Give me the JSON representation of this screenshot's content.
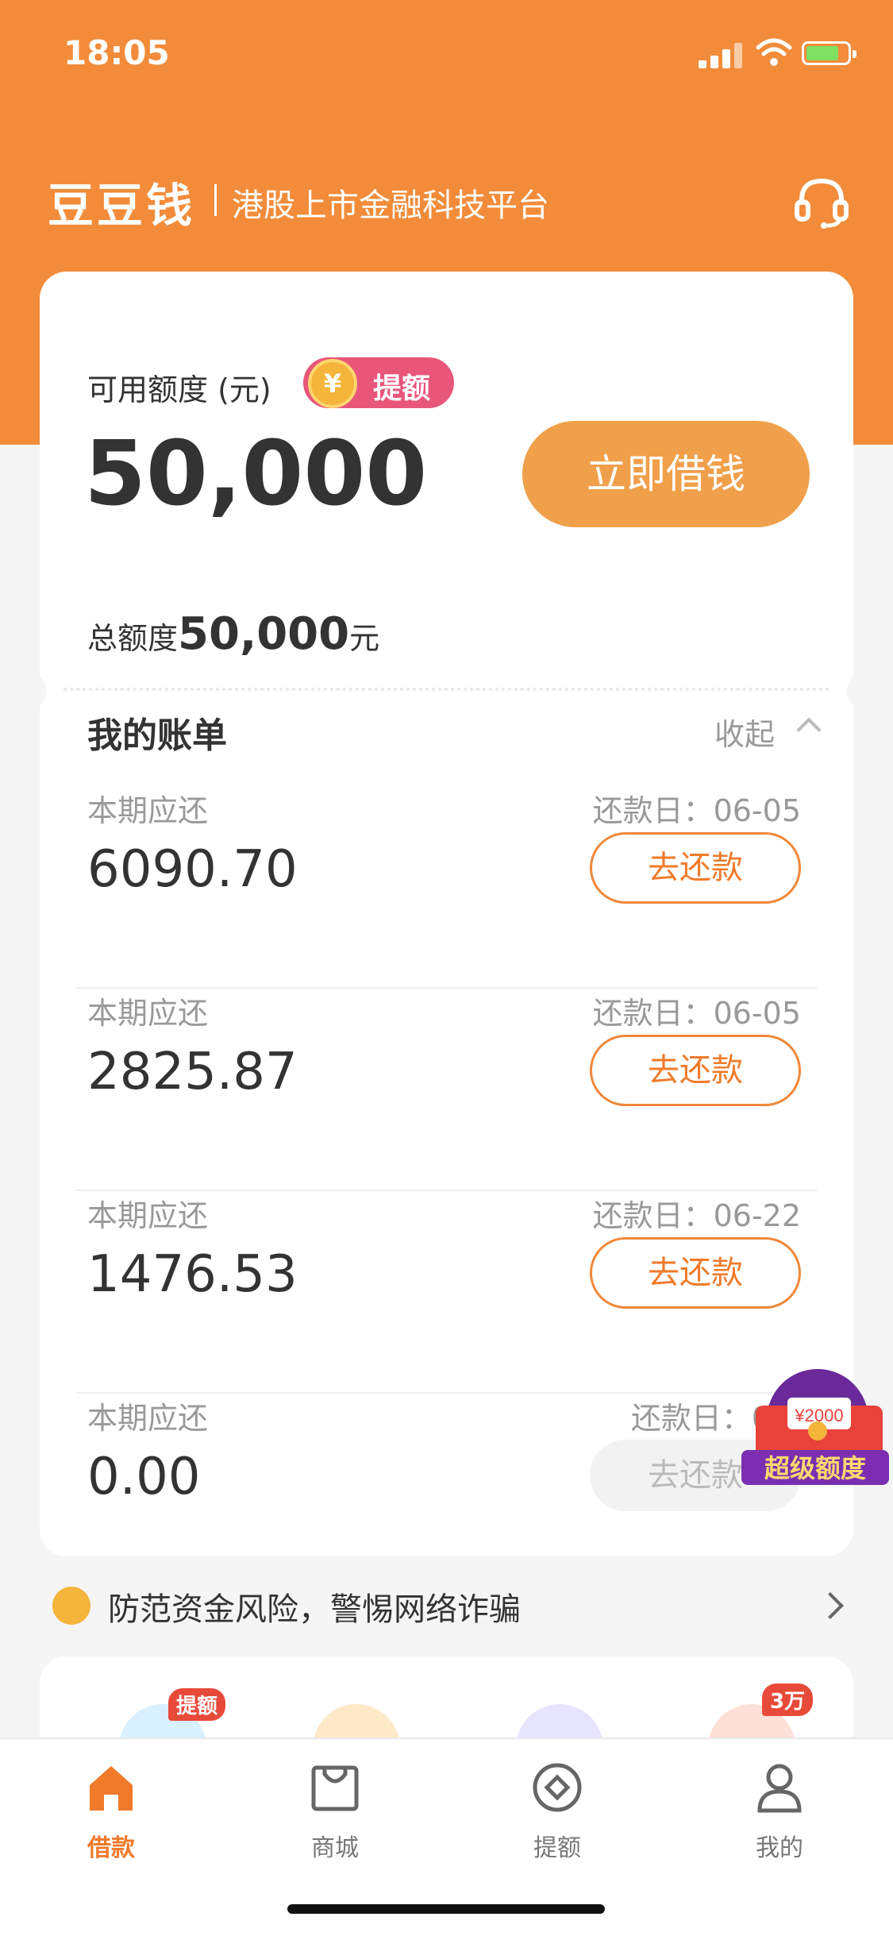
{
  "status_bar": {
    "time": "18:05"
  },
  "header": {
    "brand": "豆豆钱",
    "subtitle": "港股上市金融科技平台"
  },
  "credit": {
    "available_label": "可用额度 (元)",
    "coin_symbol": "¥",
    "raise_label": "提额",
    "available_amount": "50,000",
    "borrow_button": "立即借钱",
    "total_label": "总额度",
    "total_amount": "50,000",
    "total_unit": "元"
  },
  "bills": {
    "title": "我的账单",
    "collapse_label": "收起",
    "items": [
      {
        "due_label": "本期应还",
        "date_label": "还款日：06-05",
        "amount": "6090.70",
        "button": "去还款",
        "enabled": true
      },
      {
        "due_label": "本期应还",
        "date_label": "还款日：06-05",
        "amount": "2825.87",
        "button": "去还款",
        "enabled": true
      },
      {
        "due_label": "本期应还",
        "date_label": "还款日：06-22",
        "amount": "1476.53",
        "button": "去还款",
        "enabled": true
      },
      {
        "due_label": "本期应还",
        "date_label": "还款日：06-",
        "amount": "0.00",
        "button": "去还款",
        "enabled": false
      }
    ]
  },
  "promo": {
    "amount": "¥2000",
    "label": "超级额度"
  },
  "notice": {
    "text": "防范资金风险，警惕网络诈骗"
  },
  "quick_entries": {
    "badge1": "提额",
    "badge4": "3万"
  },
  "tabs": [
    {
      "label": "借款",
      "icon": "home-icon",
      "active": true
    },
    {
      "label": "商城",
      "icon": "shopping-bag-icon",
      "active": false
    },
    {
      "label": "提额",
      "icon": "diamond-circle-icon",
      "active": false
    },
    {
      "label": "我的",
      "icon": "user-icon",
      "active": false
    }
  ],
  "colors": {
    "accent": "#f28c3a",
    "button": "#f0a04a",
    "pill": "#e8567a",
    "active_tab": "#f07a2a"
  }
}
